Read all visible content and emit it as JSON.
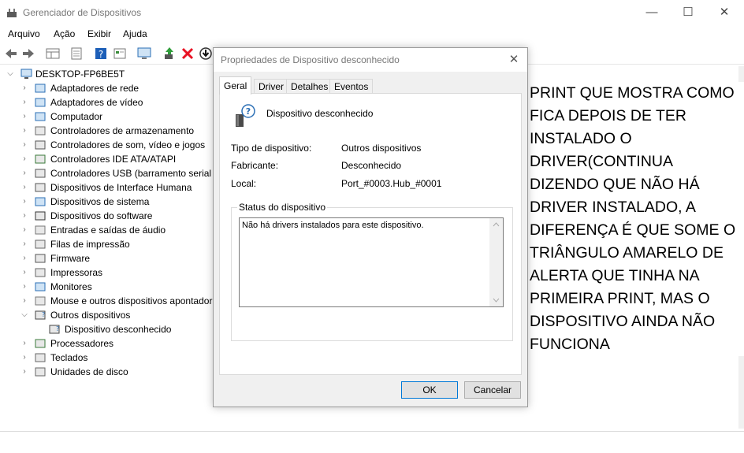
{
  "window": {
    "title": "Gerenciador de Dispositivos",
    "minimize": "—",
    "maximize": "☐",
    "close": "✕"
  },
  "menu": [
    "Arquivo",
    "Ação",
    "Exibir",
    "Ajuda"
  ],
  "toolbar": {
    "icons": [
      "back-arrow-icon",
      "forward-arrow-icon",
      "properties-grid-icon",
      "device-view-icon",
      "help-icon",
      "details-icon",
      "monitor-scan-icon",
      "update-driver-icon",
      "uninstall-x-icon",
      "download-icon"
    ]
  },
  "tree": {
    "root": "DESKTOP-FP6BE5T",
    "categories": [
      {
        "label": "Adaptadores de rede",
        "icon": "network-adapter-icon"
      },
      {
        "label": "Adaptadores de vídeo",
        "icon": "display-adapter-icon"
      },
      {
        "label": "Computador",
        "icon": "computer-icon"
      },
      {
        "label": "Controladores de armazenamento",
        "icon": "storage-controller-icon"
      },
      {
        "label": "Controladores de som, vídeo e jogos",
        "icon": "sound-icon"
      },
      {
        "label": "Controladores IDE ATA/ATAPI",
        "icon": "ide-controller-icon"
      },
      {
        "label": "Controladores USB (barramento serial universal)",
        "icon": "usb-icon"
      },
      {
        "label": "Dispositivos de Interface Humana",
        "icon": "hid-icon"
      },
      {
        "label": "Dispositivos de sistema",
        "icon": "system-device-icon"
      },
      {
        "label": "Dispositivos do software",
        "icon": "software-device-icon"
      },
      {
        "label": "Entradas e saídas de áudio",
        "icon": "audio-io-icon"
      },
      {
        "label": "Filas de impressão",
        "icon": "print-queue-icon"
      },
      {
        "label": "Firmware",
        "icon": "firmware-icon"
      },
      {
        "label": "Impressoras",
        "icon": "printer-icon"
      },
      {
        "label": "Monitores",
        "icon": "monitor-icon"
      },
      {
        "label": "Mouse e outros dispositivos apontadores",
        "icon": "mouse-icon"
      },
      {
        "label": "Outros dispositivos",
        "icon": "other-devices-icon",
        "expanded": true
      },
      {
        "label": "Dispositivo desconhecido",
        "icon": "unknown-device-icon",
        "child": true
      },
      {
        "label": "Processadores",
        "icon": "processor-icon"
      },
      {
        "label": "Teclados",
        "icon": "keyboard-icon"
      },
      {
        "label": "Unidades de disco",
        "icon": "disk-drive-icon"
      }
    ]
  },
  "overlay_note": "PRINT QUE MOSTRA COMO FICA DEPOIS DE TER INSTALADO O DRIVER(CONTINUA DIZENDO QUE NÃO HÁ DRIVER INSTALADO, A DIFERENÇA É QUE SOME O TRIÂNGULO AMARELO DE ALERTA QUE TINHA NA PRIMEIRA PRINT, MAS O DISPOSITIVO AINDA NÃO FUNCIONA",
  "dialog": {
    "title": "Propriedades de Dispositivo desconhecido",
    "close": "✕",
    "tabs": [
      "Geral",
      "Driver",
      "Detalhes",
      "Eventos"
    ],
    "device_name": "Dispositivo desconhecido",
    "props": [
      {
        "label": "Tipo de dispositivo:",
        "value": "Outros dispositivos"
      },
      {
        "label": "Fabricante:",
        "value": "Desconhecido"
      },
      {
        "label": "Local:",
        "value": "Port_#0003.Hub_#0001"
      }
    ],
    "status_legend": "Status do dispositivo",
    "status_text": "Não há drivers instalados para este dispositivo.",
    "ok_label": "OK",
    "cancel_label": "Cancelar"
  },
  "colors": {
    "accent": "#0078d7",
    "dialog_bg": "#f0f0f0",
    "uninstall_red": "#e81123"
  }
}
